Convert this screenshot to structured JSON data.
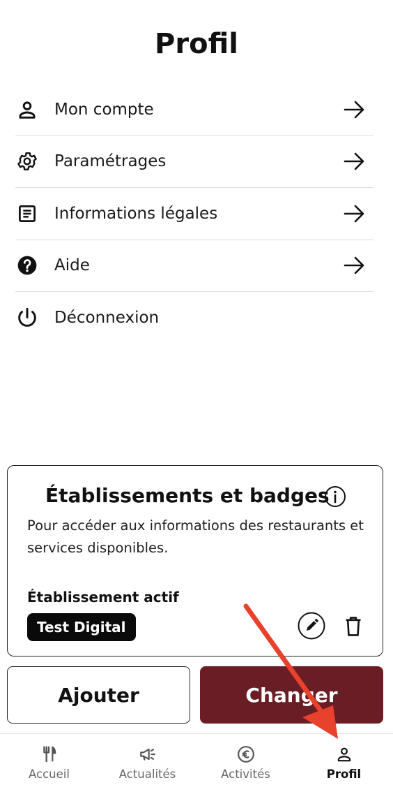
{
  "header": {
    "title": "Profil"
  },
  "menu": {
    "items": [
      {
        "label": "Mon compte",
        "icon": "person-icon",
        "has_arrow": true
      },
      {
        "label": "Paramétrages",
        "icon": "gear-icon",
        "has_arrow": true
      },
      {
        "label": "Informations légales",
        "icon": "document-icon",
        "has_arrow": true
      },
      {
        "label": "Aide",
        "icon": "help-icon",
        "has_arrow": true
      },
      {
        "label": "Déconnexion",
        "icon": "power-icon",
        "has_arrow": false
      }
    ]
  },
  "establishments": {
    "title": "Établissements et badges",
    "description": "Pour accéder aux informations des restaurants et services disponibles.",
    "active_label": "Établissement actif",
    "active_name": "Test Digital"
  },
  "actions": {
    "add_label": "Ajouter",
    "change_label": "Changer"
  },
  "bottom_nav": {
    "tabs": [
      {
        "label": "Accueil",
        "icon": "fork-knife-icon",
        "active": false
      },
      {
        "label": "Actualités",
        "icon": "megaphone-icon",
        "active": false
      },
      {
        "label": "Activités",
        "icon": "euro-icon",
        "active": false
      },
      {
        "label": "Profil",
        "icon": "person-icon",
        "active": true
      }
    ]
  },
  "colors": {
    "primary": "#6b1d25",
    "badge_bg": "#0a0a0a",
    "annotation_arrow": "#e8412c"
  }
}
